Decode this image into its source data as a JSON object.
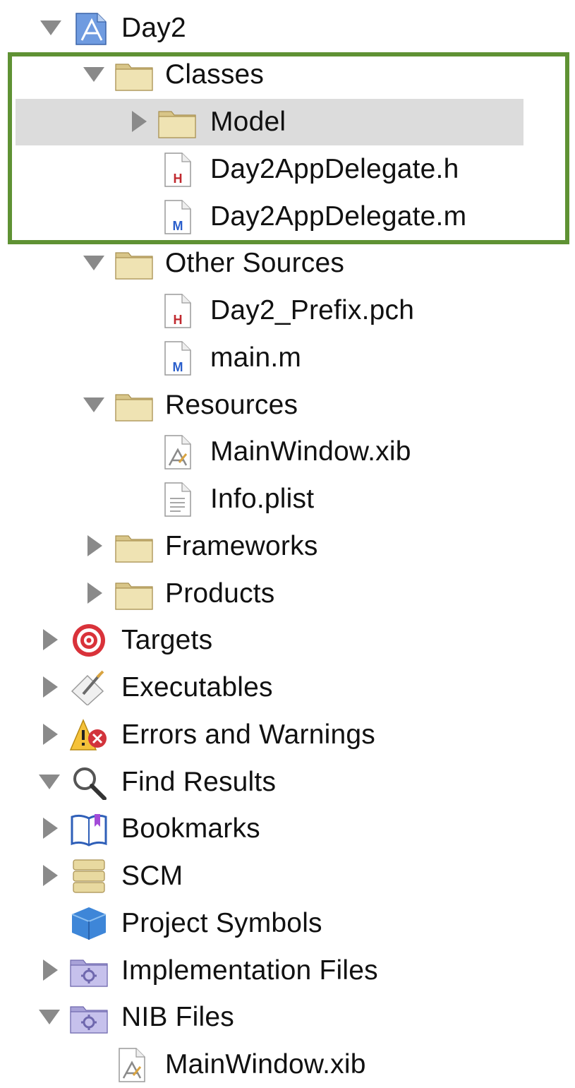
{
  "tree": {
    "items": [
      {
        "label": "Day2",
        "icon": "xcode-project-icon",
        "disclosure": "expanded"
      },
      {
        "label": "Classes",
        "icon": "folder-icon",
        "disclosure": "expanded"
      },
      {
        "label": "Model",
        "icon": "folder-icon",
        "disclosure": "collapsed",
        "selected": true
      },
      {
        "label": "Day2AppDelegate.h",
        "icon": "header-file-icon",
        "disclosure": "none"
      },
      {
        "label": "Day2AppDelegate.m",
        "icon": "implementation-file-icon",
        "disclosure": "none"
      },
      {
        "label": "Other Sources",
        "icon": "folder-icon",
        "disclosure": "expanded"
      },
      {
        "label": "Day2_Prefix.pch",
        "icon": "header-file-icon",
        "disclosure": "none"
      },
      {
        "label": "main.m",
        "icon": "implementation-file-icon",
        "disclosure": "none"
      },
      {
        "label": "Resources",
        "icon": "folder-icon",
        "disclosure": "expanded"
      },
      {
        "label": "MainWindow.xib",
        "icon": "xib-file-icon",
        "disclosure": "none"
      },
      {
        "label": "Info.plist",
        "icon": "plist-file-icon",
        "disclosure": "none"
      },
      {
        "label": "Frameworks",
        "icon": "folder-icon",
        "disclosure": "collapsed"
      },
      {
        "label": "Products",
        "icon": "folder-icon",
        "disclosure": "collapsed"
      },
      {
        "label": "Targets",
        "icon": "target-icon",
        "disclosure": "collapsed"
      },
      {
        "label": "Executables",
        "icon": "executables-icon",
        "disclosure": "collapsed"
      },
      {
        "label": "Errors and Warnings",
        "icon": "warning-icon",
        "disclosure": "collapsed"
      },
      {
        "label": "Find Results",
        "icon": "magnifier-icon",
        "disclosure": "expanded"
      },
      {
        "label": "Bookmarks",
        "icon": "bookmarks-icon",
        "disclosure": "collapsed"
      },
      {
        "label": "SCM",
        "icon": "scm-icon",
        "disclosure": "collapsed"
      },
      {
        "label": "Project Symbols",
        "icon": "cube-icon",
        "disclosure": "none"
      },
      {
        "label": "Implementation Files",
        "icon": "smart-group-icon",
        "disclosure": "collapsed"
      },
      {
        "label": "NIB Files",
        "icon": "smart-group-icon",
        "disclosure": "expanded"
      },
      {
        "label": "MainWindow.xib",
        "icon": "xib-file-icon",
        "disclosure": "none"
      }
    ]
  },
  "colors": {
    "selection_box": "#5f9234",
    "row_highlight": "#dcdcdc"
  }
}
